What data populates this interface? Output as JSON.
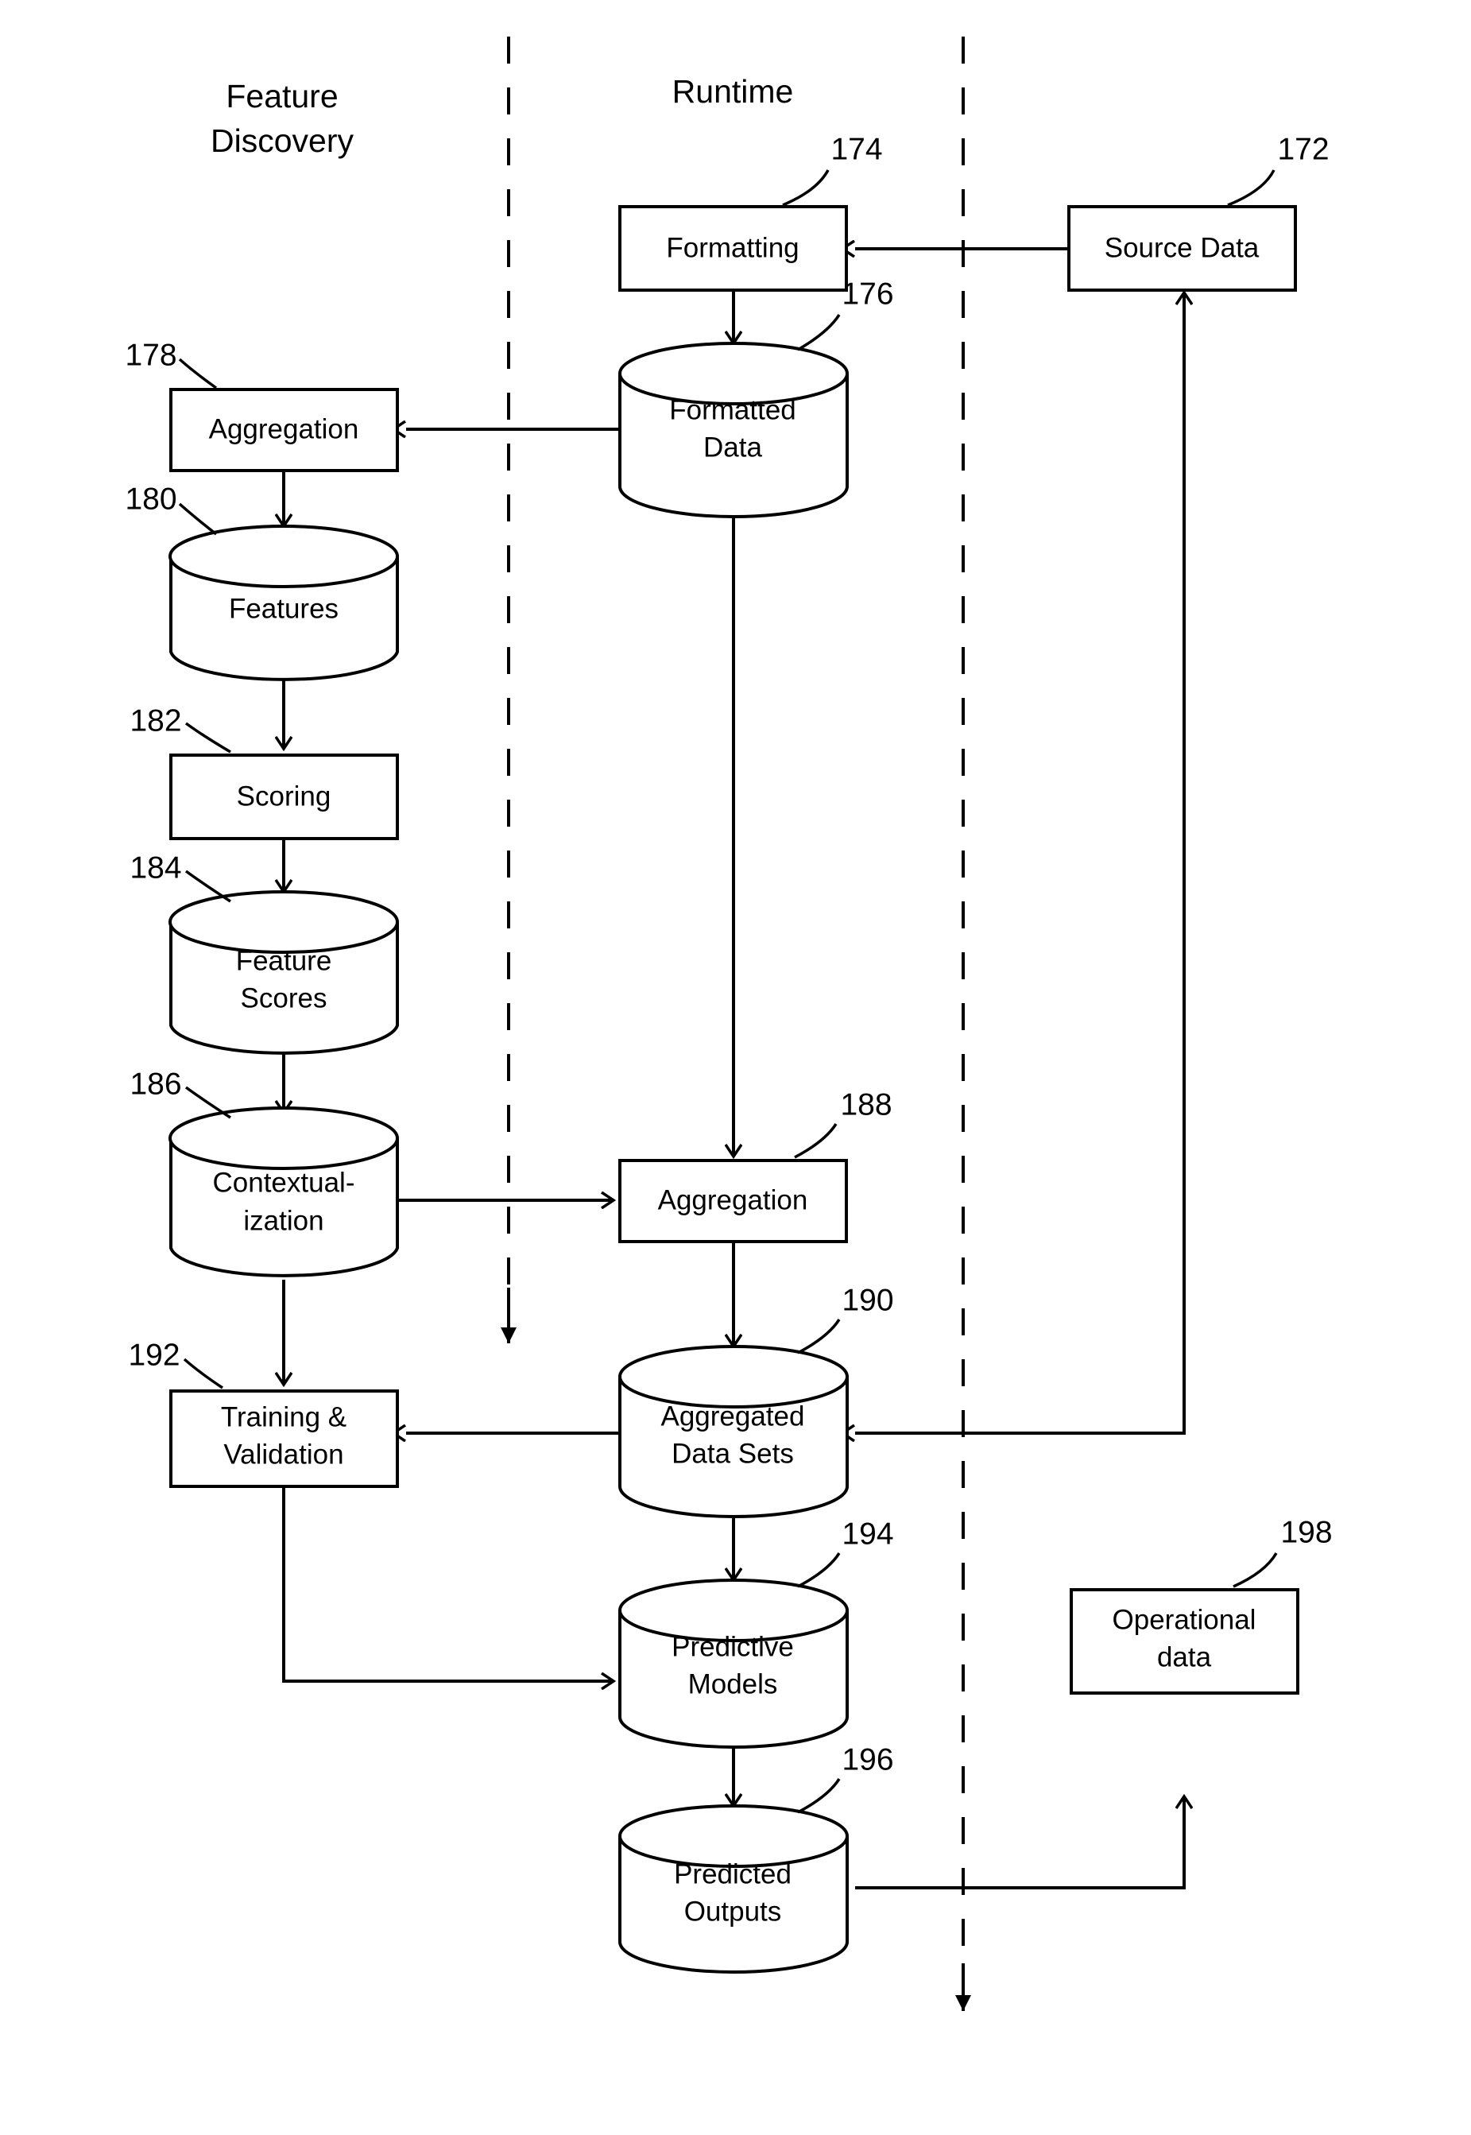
{
  "figure": {
    "type": "patent-flow-diagram",
    "background": "#ffffff",
    "stroke_color": "#000000"
  },
  "lanes": [
    {
      "id": "feature-discovery",
      "title_line1": "Feature",
      "title_line2": "Discovery"
    },
    {
      "id": "runtime",
      "title_line1": "Runtime",
      "title_line2": ""
    }
  ],
  "nodes": {
    "source_data": {
      "label": "Source Data",
      "ref": "172",
      "shape": "rect"
    },
    "formatting": {
      "label": "Formatting",
      "ref": "174",
      "shape": "rect"
    },
    "formatted_data_l1": {
      "label": "Formatted",
      "ref": "176",
      "shape": "cylinder"
    },
    "formatted_data_l2": {
      "label": "Data"
    },
    "aggregation_fd": {
      "label": "Aggregation",
      "ref": "178",
      "shape": "rect"
    },
    "features": {
      "label": "Features",
      "ref": "180",
      "shape": "cylinder"
    },
    "scoring": {
      "label": "Scoring",
      "ref": "182",
      "shape": "rect"
    },
    "feature_scores_l1": {
      "label": "Feature",
      "ref": "184",
      "shape": "cylinder"
    },
    "feature_scores_l2": {
      "label": "Scores"
    },
    "contextualization_l1": {
      "label": "Contextual-",
      "ref": "186",
      "shape": "cylinder"
    },
    "contextualization_l2": {
      "label": "ization"
    },
    "aggregation_rt": {
      "label": "Aggregation",
      "ref": "188",
      "shape": "rect"
    },
    "aggregated_sets_l1": {
      "label": "Aggregated",
      "ref": "190",
      "shape": "cylinder"
    },
    "aggregated_sets_l2": {
      "label": "Data Sets"
    },
    "training_l1": {
      "label": "Training &",
      "ref": "192",
      "shape": "rect"
    },
    "training_l2": {
      "label": "Validation"
    },
    "predictive_l1": {
      "label": "Predictive",
      "ref": "194",
      "shape": "cylinder"
    },
    "predictive_l2": {
      "label": "Models"
    },
    "predicted_l1": {
      "label": "Predicted",
      "ref": "196",
      "shape": "cylinder"
    },
    "predicted_l2": {
      "label": "Outputs"
    },
    "operational_l1": {
      "label": "Operational",
      "ref": "198",
      "shape": "rect"
    },
    "operational_l2": {
      "label": "data"
    }
  },
  "reference_numerals": [
    "172",
    "174",
    "176",
    "178",
    "180",
    "182",
    "184",
    "186",
    "188",
    "190",
    "192",
    "194",
    "196",
    "198"
  ]
}
